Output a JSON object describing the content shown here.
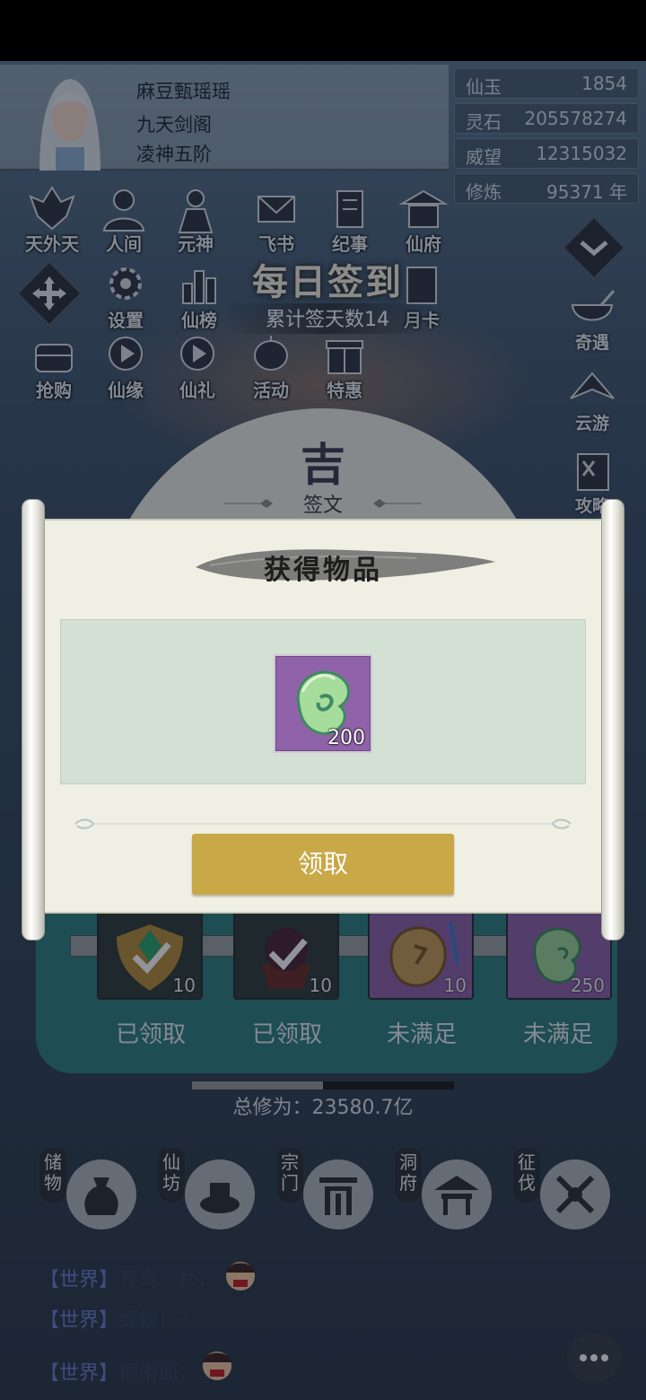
{
  "player": {
    "name": "麻豆甄瑶瑶",
    "sect": "九天剑阁",
    "realm": "凌神五阶"
  },
  "stats": [
    {
      "label": "仙玉",
      "value": "1854"
    },
    {
      "label": "灵石",
      "value": "205578274"
    },
    {
      "label": "威望",
      "value": "12315032"
    },
    {
      "label": "修炼",
      "value": "95371 年"
    }
  ],
  "menu": {
    "row1": [
      "天外天",
      "人间",
      "元神",
      "飞书",
      "纪事",
      "仙府"
    ],
    "row2": [
      "设置",
      "仙榜",
      "月卡"
    ],
    "row3": [
      "抢购",
      "仙缘",
      "仙礼",
      "活动",
      "特惠"
    ],
    "side": [
      "奇遇",
      "云游",
      "攻略"
    ]
  },
  "sign_in": {
    "title": "每日签到",
    "count_text": "累计签天数14",
    "fortune_char": "吉",
    "fortune_label": "签文"
  },
  "modal": {
    "title": "获得物品",
    "item_count": "200",
    "claim_label": "领取"
  },
  "rewards": [
    {
      "count": "10",
      "status": "已领取"
    },
    {
      "count": "10",
      "status": "已领取"
    },
    {
      "count": "10",
      "status": "未满足"
    },
    {
      "count": "250",
      "status": "未满足"
    }
  ],
  "progress": {
    "fraction": 0.5
  },
  "total_cultivation": "总修为：23580.7亿",
  "bottom_nav": [
    {
      "label": "储物"
    },
    {
      "label": "仙坊"
    },
    {
      "label": "宗门"
    },
    {
      "label": "洞府"
    },
    {
      "label": "征伐"
    }
  ],
  "chat": [
    {
      "channel": "【世界】",
      "text": "青鸟。わ："
    },
    {
      "channel": "【世界】",
      "text": "绿蚁：？"
    },
    {
      "channel": "【世界】",
      "text": "桐雨仙："
    }
  ],
  "colors": {
    "claim_button": "#c9a848",
    "item_bg": "#8f62a9",
    "panel": "#eff0e3",
    "reward_panel": "#2f7f80"
  }
}
